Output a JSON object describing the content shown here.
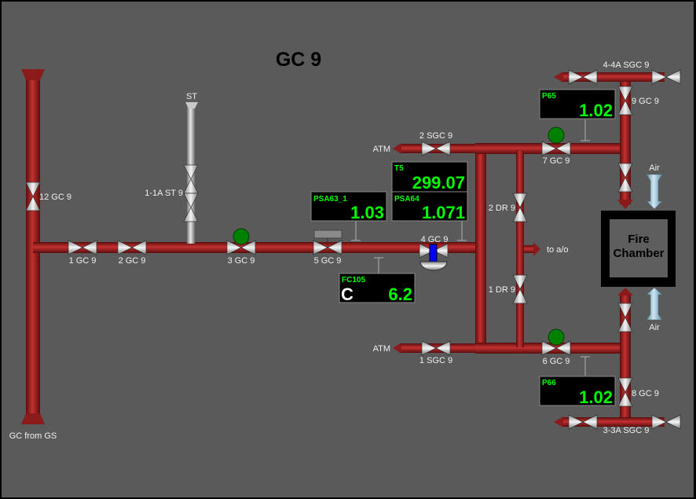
{
  "title": "GC 9",
  "colors": {
    "pipe": "#8b1a1a",
    "pipe_light": "#c43030",
    "steam": "#b8b8b8",
    "air": "#8fb7cc",
    "display_bg": "#000000",
    "display_text": "#00ff00",
    "status_on": "#008000",
    "background": "#5a5a5a",
    "actuator": "#0000ff"
  },
  "sources": {
    "gc_from_gs": "GC from GS",
    "st": "ST",
    "atm_top": "ATM",
    "atm_bottom": "ATM",
    "to_ao": "to a/o",
    "air_top": "Air",
    "air_bottom": "Air"
  },
  "valves": {
    "v12gc9": "12 GC 9",
    "v1gc9": "1 GC 9",
    "v2gc9": "2 GC 9",
    "v11ast9": "1-1A ST 9",
    "v3gc9": "3 GC 9",
    "v5gc9": "5 GC 9",
    "v4gc9": "4 GC 9",
    "v2sgc9": "2 SGC 9",
    "v1sgc9": "1 SGC 9",
    "v2dr9": "2 DR 9",
    "v1dr9": "1 DR 9",
    "v7gc9": "7 GC 9",
    "v6gc9": "6 GC 9",
    "v9gc9": "9 GC 9",
    "v8gc9": "8 GC 9",
    "v44asgc9": "4-4A SGC 9",
    "v33asgc9": "3-3A SGC 9"
  },
  "displays": {
    "psa63": {
      "tag": "PSA63_1",
      "value": "1.03"
    },
    "t5": {
      "tag": "T5",
      "value": "299.07"
    },
    "psa64": {
      "tag": "PSA64",
      "value": "1.071"
    },
    "fc105": {
      "tag": "FC105",
      "mode": "C",
      "value": "6.2"
    },
    "p65": {
      "tag": "P65",
      "value": "1.02"
    },
    "p66": {
      "tag": "P66",
      "value": "1.02"
    }
  },
  "fire_chamber": {
    "line1": "Fire",
    "line2": "Chamber"
  }
}
